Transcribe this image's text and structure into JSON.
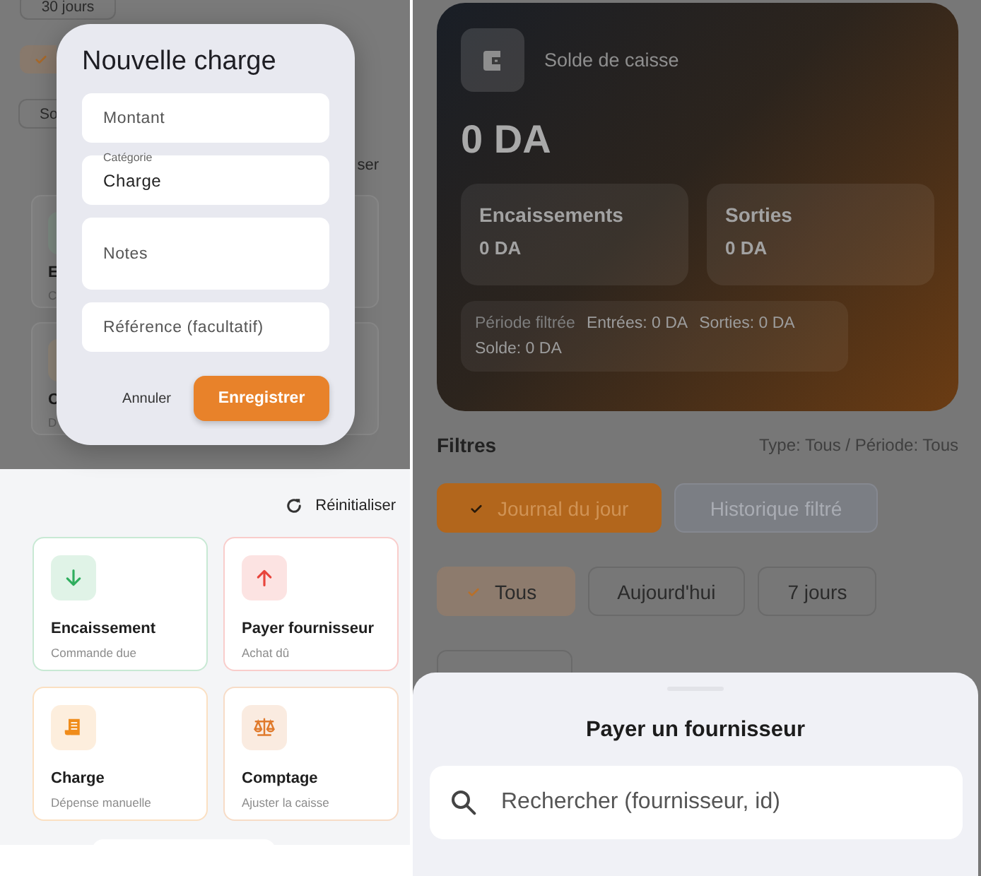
{
  "left_screen": {
    "background": {
      "chips": [
        {
          "label": "30 jours",
          "selected": false
        },
        {
          "selected": true
        },
        {
          "label": "So",
          "selected": false
        }
      ],
      "link": "ser",
      "cards": [
        {
          "kind": "card",
          "title": "E",
          "subtitle": "C"
        },
        {
          "kind": "card"
        },
        {
          "kind": "card",
          "title": "C",
          "subtitle": "D"
        },
        {
          "kind": "card"
        }
      ]
    },
    "dialog": {
      "title": "Nouvelle charge",
      "fields": [
        {
          "kind": "input",
          "placeholder": "Montant"
        },
        {
          "kind": "select",
          "label": "Catégorie",
          "value": "Charge"
        },
        {
          "kind": "textarea",
          "placeholder": "Notes"
        },
        {
          "kind": "input",
          "placeholder": "Référence (facultatif)"
        }
      ],
      "buttons": [
        {
          "kind": "text",
          "label": "Annuler"
        },
        {
          "kind": "primary",
          "label": "Enregistrer"
        }
      ]
    },
    "reset_label": "Réinitialiser",
    "cards": [
      {
        "title": "Encaissement",
        "subtitle": "Commande due",
        "color": "#2fae5e"
      },
      {
        "title": "Payer fournisseur",
        "subtitle": "Achat dû",
        "color": "#e8453c"
      },
      {
        "title": "Charge",
        "subtitle": "Dépense manuelle",
        "color": "#f08c1a"
      },
      {
        "title": "Comptage",
        "subtitle": "Ajuster la caisse",
        "color": "#e07a2c"
      }
    ]
  },
  "right_screen": {
    "balance_card": {
      "title": "Solde de caisse",
      "amount": "0 DA",
      "stats": [
        {
          "label": "Encaissements",
          "value": "0 DA"
        },
        {
          "label": "Sorties",
          "value": "0 DA"
        }
      ],
      "period": {
        "label": "Période filtrée",
        "items": [
          "Entrées: 0 DA",
          "Sorties: 0 DA",
          "Solde: 0 DA"
        ]
      }
    },
    "filters": {
      "title": "Filtres",
      "summary": "Type: Tous / Période: Tous",
      "modes": [
        {
          "label": "Journal du jour",
          "selected": true
        },
        {
          "label": "Historique filtré",
          "selected": false
        }
      ],
      "periods": [
        {
          "label": "Tous",
          "selected": true
        },
        {
          "label": "Aujourd'hui",
          "selected": false
        },
        {
          "label": "7 jours",
          "selected": false
        },
        {
          "selected": false
        }
      ]
    },
    "sheet": {
      "title": "Payer un fournisseur",
      "search": {
        "placeholder": "Rechercher (fournisseur, id)"
      }
    }
  }
}
